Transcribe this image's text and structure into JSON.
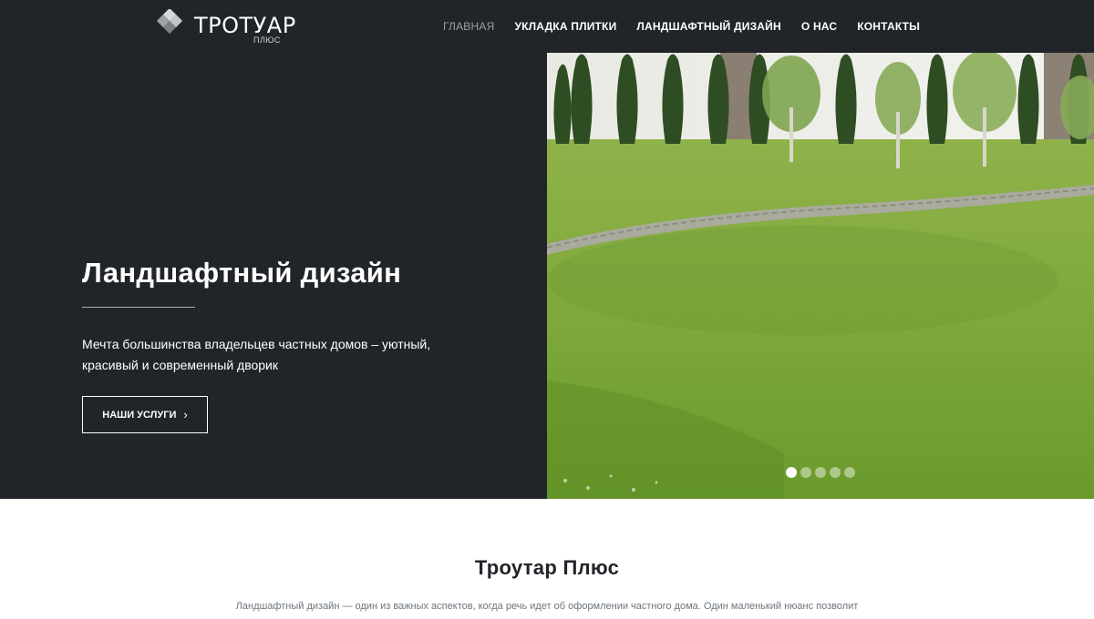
{
  "brand": {
    "title": "ТРОТУАР",
    "subtitle": "ПЛЮС"
  },
  "nav": {
    "items": [
      {
        "label": "ГЛАВНАЯ",
        "active": true
      },
      {
        "label": "УКЛАДКА ПЛИТКИ",
        "active": false
      },
      {
        "label": "ЛАНДШАФТНЫЙ ДИЗАЙН",
        "active": false
      },
      {
        "label": "О НАС",
        "active": false
      },
      {
        "label": "КОНТАКТЫ",
        "active": false
      }
    ]
  },
  "hero": {
    "title": "Ландшафтный дизайн",
    "text": "Мечта большинства владельцев частных домов – уютный, красивый и современный дворик",
    "button_label": "НАШИ УСЛУГИ",
    "button_icon": "chevron-right-icon",
    "slides_count": 5,
    "active_slide": 1
  },
  "about": {
    "title": "Троутар Плюс",
    "text": "Ландшафтный дизайн — один из важных аспектов, когда речь идет об оформлении частного дома. Один маленький нюанс позволит"
  },
  "colors": {
    "dark": "#212529",
    "white": "#ffffff",
    "muted_text": "#6c757d",
    "nav_active": "#9aa0a6"
  }
}
